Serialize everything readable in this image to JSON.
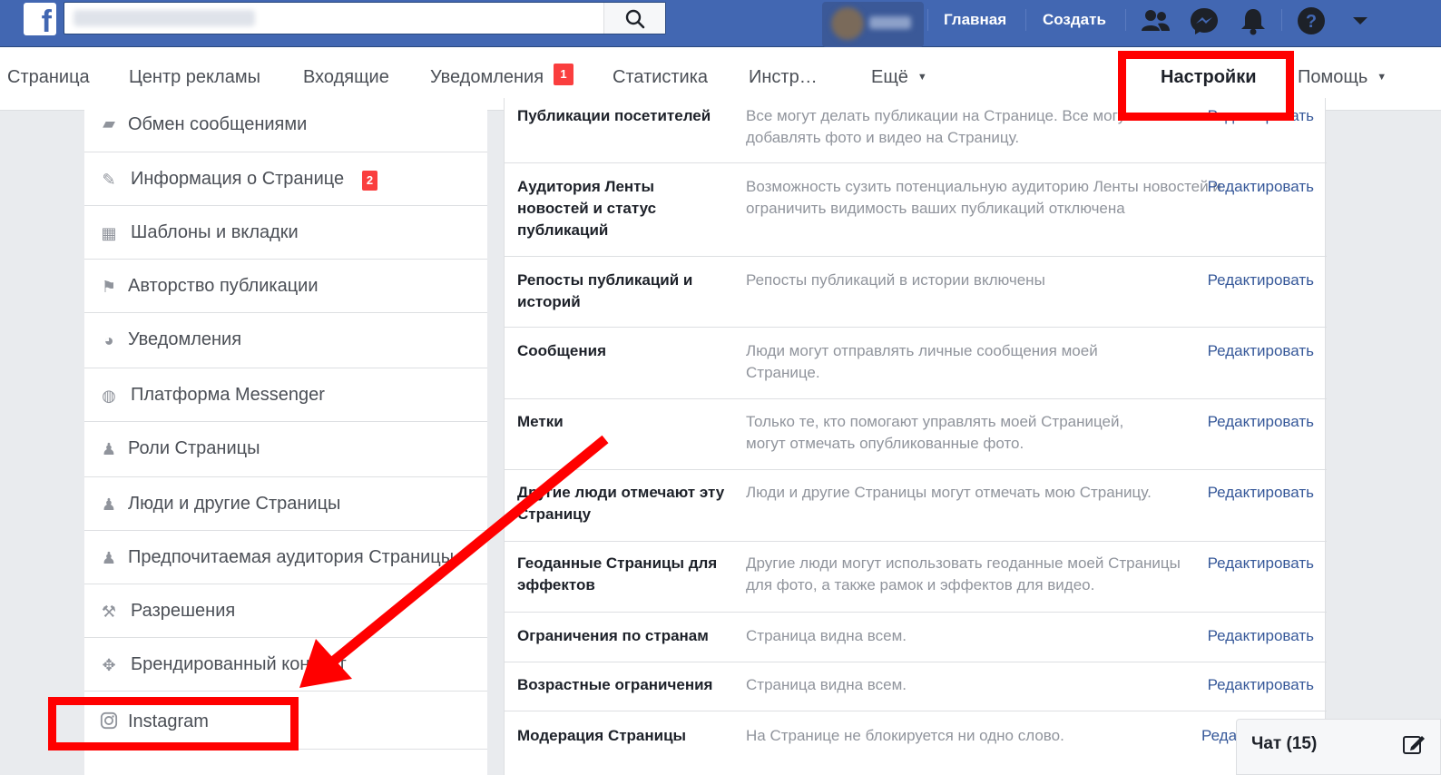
{
  "topbar": {
    "logo_letter": "f",
    "search_placeholder": "",
    "nav": {
      "home": "Главная",
      "create": "Создать"
    },
    "icons": [
      "friends-icon",
      "messenger-icon",
      "notifications-bell-icon",
      "help-icon",
      "account-menu-caret-icon"
    ]
  },
  "tabs": {
    "page": "Страница",
    "ad_center": "Центр рекламы",
    "inbox": "Входящие",
    "notifications": "Уведомления",
    "notifications_badge": "1",
    "stats": "Статистика",
    "tools": "Инстр…",
    "more": "Ещё",
    "settings": "Настройки",
    "help": "Помощь"
  },
  "sidebar": {
    "items": [
      {
        "label": "Обмен сообщениями",
        "icon": "messages-icon"
      },
      {
        "label": "Информация о Странице",
        "icon": "pencil-icon",
        "badge": "2"
      },
      {
        "label": "Шаблоны и вкладки",
        "icon": "grid-icon"
      },
      {
        "label": "Авторство публикации",
        "icon": "flag-icon"
      },
      {
        "label": "Уведомления",
        "icon": "globe-icon"
      },
      {
        "label": "Платформа Messenger",
        "icon": "messenger-icon"
      },
      {
        "label": "Роли Страницы",
        "icon": "person-icon"
      },
      {
        "label": "Люди и другие Страницы",
        "icon": "person-star-icon"
      },
      {
        "label": "Предпочитаемая аудитория Страницы",
        "icon": "person-star-icon"
      },
      {
        "label": "Разрешения",
        "icon": "wrench-icon"
      },
      {
        "label": "Брендированный контент",
        "icon": "handshake-icon"
      },
      {
        "label": "Instagram",
        "icon": "instagram-icon"
      }
    ]
  },
  "settings_rows": [
    {
      "title": "Публикации посетителей",
      "desc": "Все могут делать публикации на Странице. Все могут добавлять фото и видео на Страницу.",
      "edit": "Редактировать"
    },
    {
      "title": "Аудитория Ленты новостей и статус публикаций",
      "desc": "Возможность сузить потенциальную аудиторию Ленты новостей и ограничить видимость ваших публикаций отключена",
      "edit": "Редактировать"
    },
    {
      "title": "Репосты публикаций и историй",
      "desc": "Репосты публикаций в истории включены",
      "edit": "Редактировать"
    },
    {
      "title": "Сообщения",
      "desc": "Люди могут отправлять личные сообщения моей Странице.",
      "edit": "Редактировать"
    },
    {
      "title": "Метки",
      "desc": "Только те, кто помогают управлять моей Страницей, могут отмечать опубликованные фото.",
      "edit": "Редактировать"
    },
    {
      "title": "Другие люди отмечают эту Страницу",
      "desc": "Люди и другие Страницы могут отмечать мою Страницу.",
      "edit": "Редактировать"
    },
    {
      "title": "Геоданные Страницы для эффектов",
      "desc": "Другие люди могут использовать геоданные моей Страницы для фото, а также рамок и эффектов для видео.",
      "edit": "Редактировать"
    },
    {
      "title": "Ограничения по странам",
      "desc": "Страница видна всем.",
      "edit": "Редактировать"
    },
    {
      "title": "Возрастные ограничения",
      "desc": "Страница видна всем.",
      "edit": "Редактировать"
    },
    {
      "title": "Модерация Страницы",
      "desc": "На Странице не блокируется ни одно слово.",
      "edit": "Реда"
    }
  ],
  "chat": {
    "label": "Чат (15)",
    "icon": "compose-icon"
  },
  "annotation": {
    "color": "#ff0000"
  }
}
